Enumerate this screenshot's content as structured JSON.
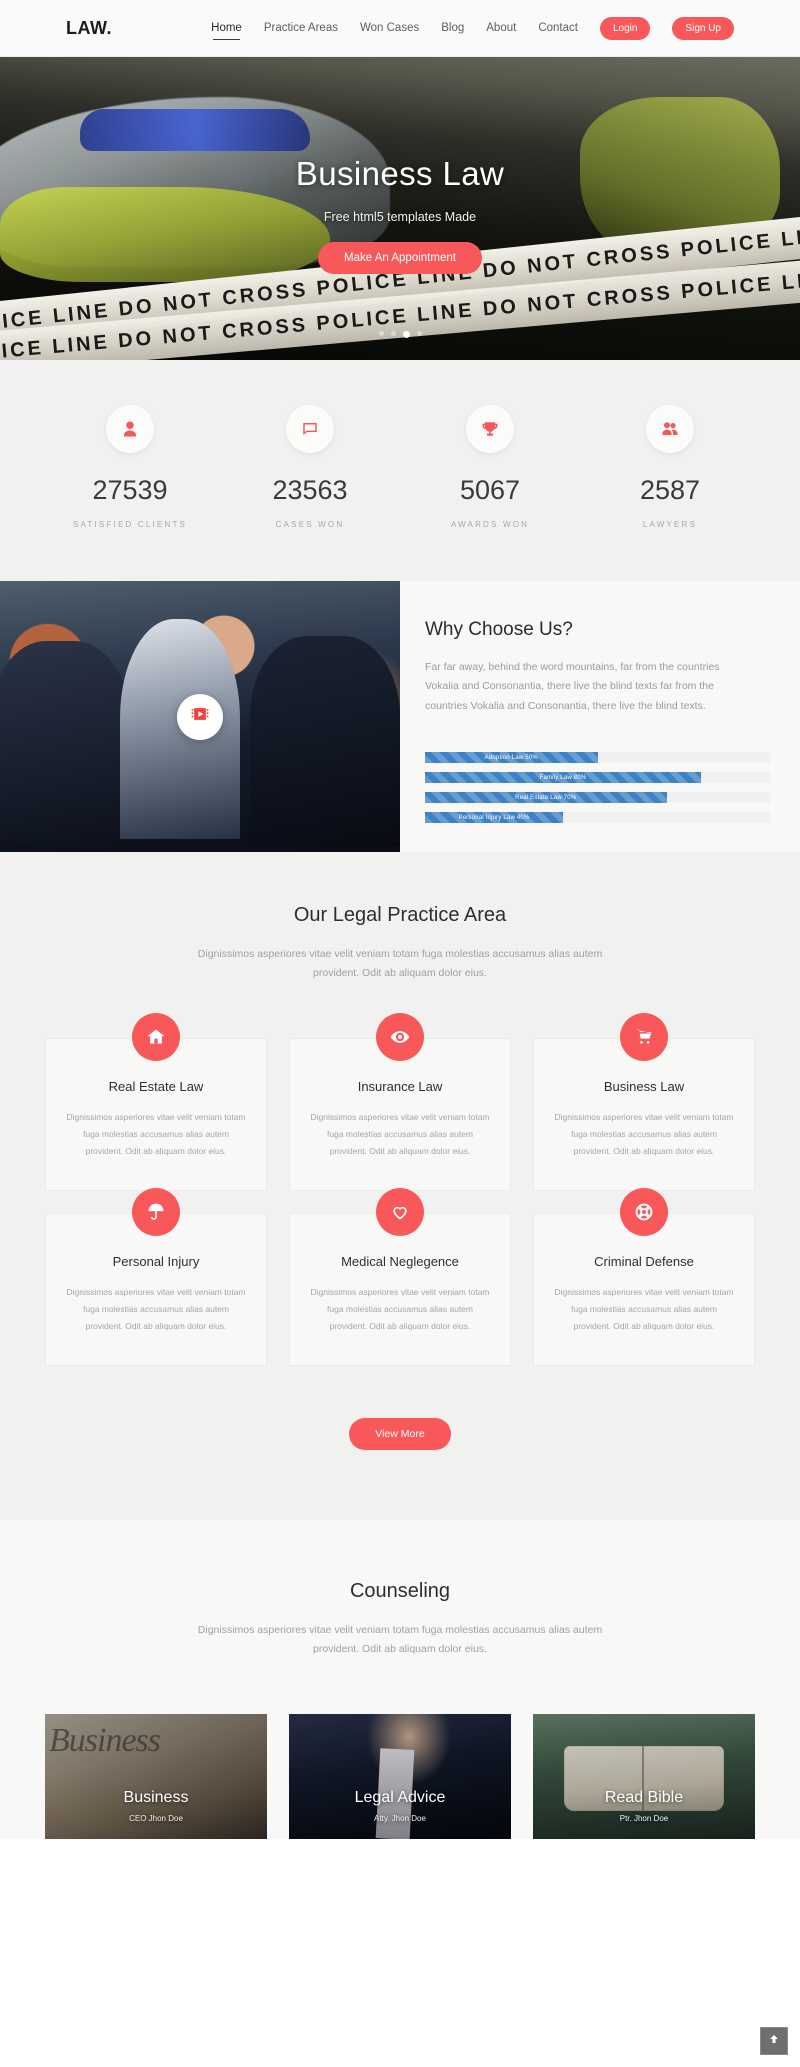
{
  "nav": {
    "brand": "LAW.",
    "links": [
      {
        "label": "Home",
        "active": true
      },
      {
        "label": "Practice Areas",
        "active": false
      },
      {
        "label": "Won Cases",
        "active": false
      },
      {
        "label": "Blog",
        "active": false
      },
      {
        "label": "About",
        "active": false
      },
      {
        "label": "Contact",
        "active": false
      }
    ],
    "login_label": "Login",
    "signup_label": "Sign Up"
  },
  "hero": {
    "title": "Business Law",
    "subtitle": "Free html5 templates Made",
    "cta_label": "Make An Appointment",
    "tape_text": "POLICE LINE DO NOT CROSS POLICE LINE DO NOT CROSS POLICE LINE",
    "slides": 4,
    "active_slide": 3
  },
  "counters": [
    {
      "icon": "user-icon",
      "value": "27539",
      "label": "Satisfied Clients"
    },
    {
      "icon": "comment-icon",
      "value": "23563",
      "label": "Cases Won"
    },
    {
      "icon": "trophy-icon",
      "value": "5067",
      "label": "Awards Won"
    },
    {
      "icon": "users-icon",
      "value": "2587",
      "label": "Lawyers"
    }
  ],
  "why": {
    "title": "Why Choose Us?",
    "text": "Far far away, behind the word mountains, far from the countries Vokalia and Consonantia, there live the blind texts far from the countries Vokalia and Consonantia, there live the blind texts.",
    "play_icon": "video-play-icon",
    "skills": [
      {
        "label": "Adoption Law 50%",
        "value": 50
      },
      {
        "label": "Family Law 80%",
        "value": 80
      },
      {
        "label": "Real Estate Law 70%",
        "value": 70
      },
      {
        "label": "Personal Injury Law 40%",
        "value": 40
      }
    ]
  },
  "practice": {
    "title": "Our Legal Practice Area",
    "subtitle": "Dignissimos asperiores vitae velit veniam totam fuga molestias accusamus alias autem provident. Odit ab aliquam dolor eius.",
    "view_more_label": "View More",
    "card_text": "Dignissimos asperiores vitae velit veniam totam fuga molestias accusamus alias autem provident. Odit ab aliquam dolor eius.",
    "cards": [
      {
        "icon": "home-icon",
        "title": "Real Estate Law"
      },
      {
        "icon": "eye-icon",
        "title": "Insurance Law"
      },
      {
        "icon": "shopping-cart-icon",
        "title": "Business Law"
      },
      {
        "icon": "umbrella-icon",
        "title": "Personal Injury"
      },
      {
        "icon": "heart-icon",
        "title": "Medical Neglegence"
      },
      {
        "icon": "lifebuoy-icon",
        "title": "Criminal Defense"
      }
    ]
  },
  "counseling": {
    "title": "Counseling",
    "subtitle": "Dignissimos asperiores vitae velit veniam totam fuga molestias accusamus alias autem provident. Odit ab aliquam dolor eius.",
    "cards": [
      {
        "name": "Business",
        "role": "CEO Jhon Doe",
        "art": "art-business"
      },
      {
        "name": "Legal Advice",
        "role": "Atty. Jhon Doe",
        "art": "art-legal"
      },
      {
        "name": "Read Bible",
        "role": "Ptr. Jhon Doe",
        "art": "art-bible"
      }
    ]
  },
  "scroll_top": {
    "icon": "arrow-up-icon"
  },
  "colors": {
    "accent": "#f9585b",
    "icon_red": "#f05a5d",
    "skill_blue": "#3c82c4",
    "bg_light": "#f8f8f7",
    "bg_grey": "#f1f1ef"
  }
}
